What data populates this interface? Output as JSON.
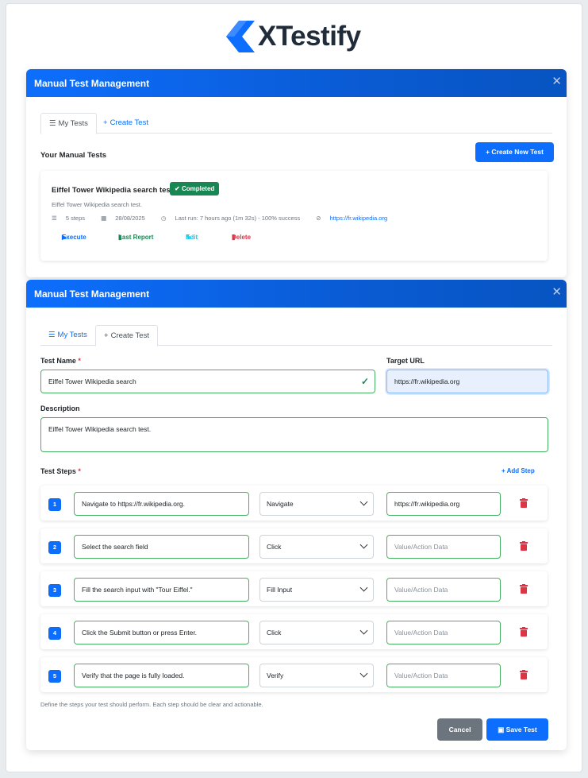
{
  "brand": {
    "name": "XTestify",
    "logo_color": "#0d6efd"
  },
  "colors": {
    "primary": "#0d6efd",
    "success": "#198754",
    "danger": "#dc3545",
    "info": "#0dcaf0",
    "secondary": "#6c757d"
  },
  "panel1": {
    "title": "Manual Test Management",
    "close_icon": "close-icon",
    "tabs": [
      {
        "icon": "list-icon",
        "label": "My Tests",
        "active": true
      },
      {
        "icon": "plus-icon",
        "label": "Create Test",
        "active": false
      }
    ],
    "section_title": "Your Manual Tests",
    "create_button": "Create New Test",
    "test": {
      "title": "Eiffel Tower Wikipedia search test.",
      "status": "Completed",
      "description": "Eiffel Tower Wikipedia search test.",
      "steps": "5 steps",
      "date": "28/08/2025",
      "last_run": "Last run: 7 hours ago (1m 32s) - 100% success",
      "url": "https://fr.wikipedia.org",
      "actions": {
        "execute": "Execute",
        "report": "Last Report",
        "edit": "Edit",
        "delete": "Delete"
      }
    }
  },
  "panel2": {
    "title": "Manual Test Management",
    "tabs": [
      {
        "icon": "list-icon",
        "label": "My Tests",
        "active": false
      },
      {
        "icon": "plus-icon",
        "label": "Create Test",
        "active": true
      }
    ],
    "form": {
      "test_name_label": "Test Name",
      "test_name_value": "Eiffel Tower Wikipedia search",
      "target_url_label": "Target URL",
      "target_url_value": "https://fr.wikipedia.org",
      "description_label": "Description",
      "description_value": "Eiffel Tower Wikipedia search test.",
      "steps_label": "Test Steps",
      "add_step": "Add Step",
      "required_mark": "*",
      "value_placeholder": "Value/Action Data",
      "steps": [
        {
          "num": "1",
          "description": "Navigate to https://fr.wikipedia.org.",
          "action": "Navigate",
          "value": "https://fr.wikipedia.org"
        },
        {
          "num": "2",
          "description": "Select the search field",
          "action": "Click",
          "value": ""
        },
        {
          "num": "3",
          "description": "Fill the search input with \"Tour Eiffel.\"",
          "action": "Fill Input",
          "value": ""
        },
        {
          "num": "4",
          "description": "Click the Submit button or press Enter.",
          "action": "Click",
          "value": ""
        },
        {
          "num": "5",
          "description": "Verify that the page is fully loaded.",
          "action": "Verify",
          "value": ""
        }
      ],
      "help_text": "Define the steps your test should perform. Each step should be clear and actionable.",
      "cancel": "Cancel",
      "save": "Save Test"
    }
  }
}
